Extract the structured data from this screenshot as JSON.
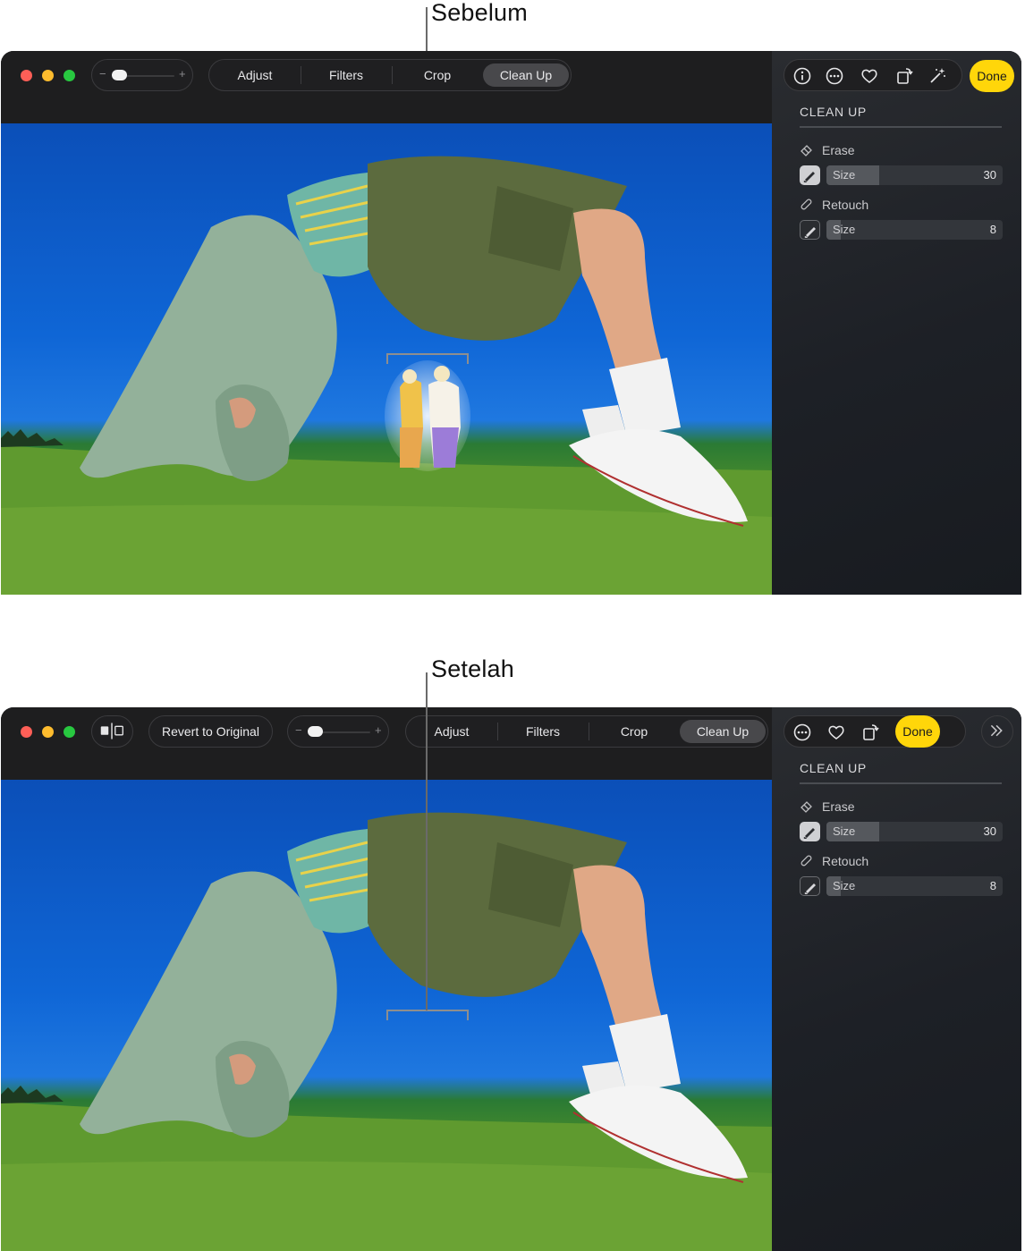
{
  "callouts": {
    "before": "Sebelum",
    "after": "Setelah"
  },
  "before_window": {
    "tabs": [
      {
        "label": "Adjust",
        "active": false
      },
      {
        "label": "Filters",
        "active": false
      },
      {
        "label": "Crop",
        "active": false
      },
      {
        "label": "Clean Up",
        "active": true
      }
    ],
    "zoom": {
      "minus": "−",
      "plus": "+",
      "level": 0.3
    },
    "toolbar_icons": [
      "info-icon",
      "more-icon",
      "heart-icon",
      "rotate-icon",
      "magic-wand-icon"
    ],
    "done_label": "Done"
  },
  "after_window": {
    "revert_label": "Revert to Original",
    "tabs": [
      {
        "label": "Adjust",
        "active": false
      },
      {
        "label": "Filters",
        "active": false
      },
      {
        "label": "Crop",
        "active": false
      },
      {
        "label": "Clean Up",
        "active": true
      }
    ],
    "zoom": {
      "minus": "−",
      "plus": "+",
      "level": 0.3
    },
    "toolbar_icons": [
      "more-icon",
      "heart-icon",
      "rotate-icon"
    ],
    "done_label": "Done"
  },
  "sidebar": {
    "title": "CLEAN UP",
    "erase": {
      "label": "Erase",
      "size_label": "Size",
      "size_value": "30",
      "size_fraction": 0.3
    },
    "retouch": {
      "label": "Retouch",
      "size_label": "Size",
      "size_value": "8",
      "size_fraction": 0.08
    }
  },
  "colors": {
    "accent": "#ffd60a",
    "sky": "#0f66d6",
    "grass": "#5a962e"
  }
}
